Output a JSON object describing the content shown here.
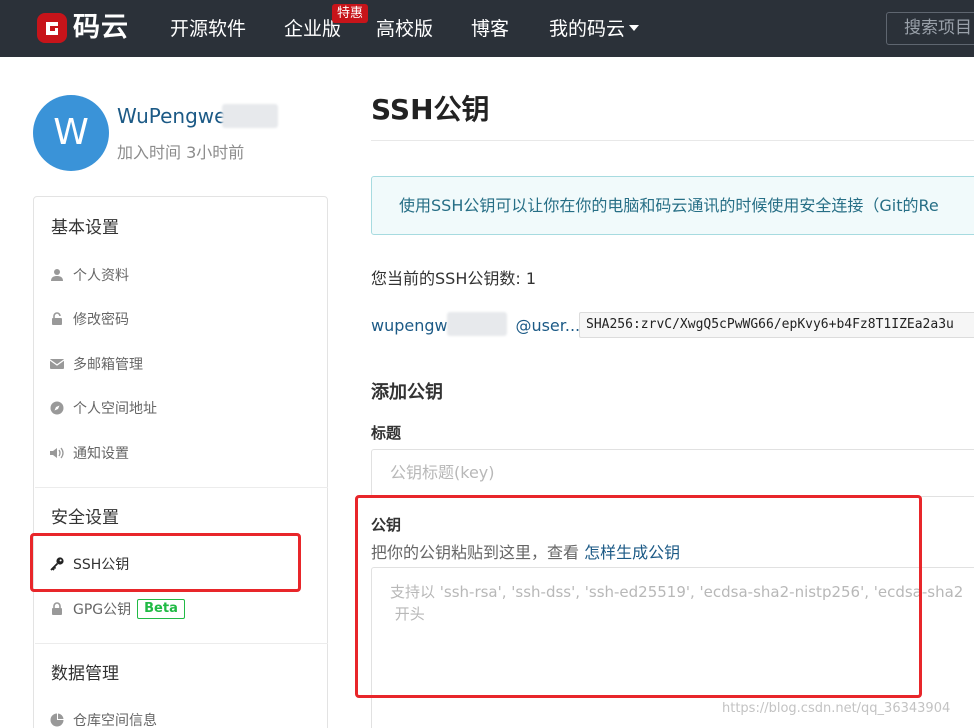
{
  "brand": {
    "logo_text": "码云",
    "logo_color": "#c7141a"
  },
  "nav": {
    "items": [
      "开源软件",
      "企业版",
      "高校版",
      "博客",
      "我的码云"
    ],
    "enterprise_badge": "特惠",
    "search_placeholder": "搜索项目"
  },
  "profile": {
    "avatar_letter": "W",
    "username": "WuPengwei",
    "join_time": "加入时间 3小时前"
  },
  "sidebar": {
    "sections": [
      {
        "title": "基本设置",
        "items": [
          "个人资料",
          "修改密码",
          "多邮箱管理",
          "个人空间地址",
          "通知设置"
        ]
      },
      {
        "title": "安全设置",
        "items": [
          "SSH公钥",
          "GPG公钥"
        ]
      },
      {
        "title": "数据管理",
        "items": [
          "仓库空间信息"
        ]
      }
    ],
    "gpg_badge": "Beta"
  },
  "main": {
    "title": "SSH公钥",
    "info_text": "使用SSH公钥可以让你在你的电脑和码云通讯的时候使用安全连接（Git的Re",
    "key_count_text": "您当前的SSH公钥数: 1",
    "key_owner_prefix": "wupengwe",
    "key_owner_suffix": "@user....",
    "fingerprint": "SHA256:zrvC/XwgQ5cPwWG66/epKvy6+b4Fz8T1IZEa2a3u",
    "add_section_title": "添加公钥",
    "title_label": "标题",
    "title_placeholder": "公钥标题(key)",
    "key_label": "公钥",
    "key_hint": "把你的公钥粘贴到这里，查看 ",
    "key_hint_link": "怎样生成公钥",
    "key_placeholder": "支持以 'ssh-rsa', 'ssh-dss', 'ssh-ed25519', 'ecdsa-sha2-nistp256', 'ecdsa-sha2\n 开头"
  },
  "watermark": "https://blog.csdn.net/qq_36343904",
  "colors": {
    "topbar": "#2b3139",
    "link": "#1c5a86",
    "annotation": "#e8262a",
    "beta": "#21ba45",
    "avatar": "#3a93d8"
  }
}
